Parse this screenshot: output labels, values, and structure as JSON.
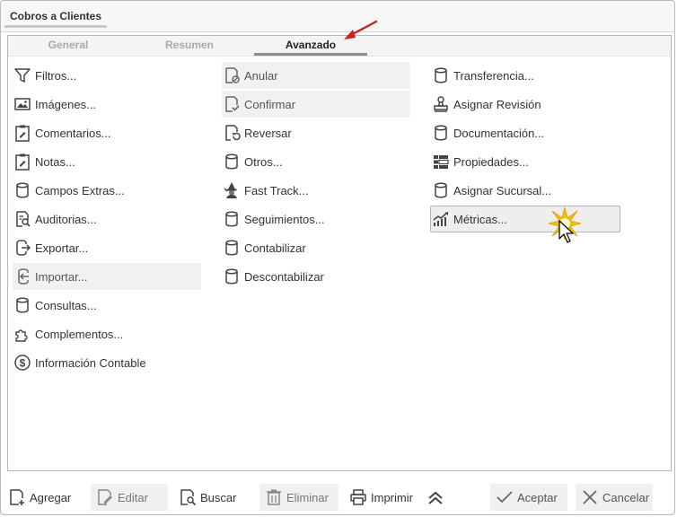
{
  "window": {
    "title": "Cobros a Clientes"
  },
  "tabs": [
    {
      "label": "General",
      "active": false
    },
    {
      "label": "Resumen",
      "active": false
    },
    {
      "label": "Avanzado",
      "active": true
    }
  ],
  "columns": {
    "left": [
      {
        "label": "Filtros...",
        "icon": "filter-icon"
      },
      {
        "label": "Imágenes...",
        "icon": "image-icon"
      },
      {
        "label": "Comentarios...",
        "icon": "clipboard-edit-icon"
      },
      {
        "label": "Notas...",
        "icon": "clipboard-edit-icon"
      },
      {
        "label": "Campos Extras...",
        "icon": "database-icon"
      },
      {
        "label": "Auditorias...",
        "icon": "audit-icon"
      },
      {
        "label": "Exportar...",
        "icon": "export-icon"
      },
      {
        "label": "Importar...",
        "icon": "import-icon"
      },
      {
        "label": "Consultas...",
        "icon": "database-icon"
      },
      {
        "label": "Complementos...",
        "icon": "puzzle-icon"
      },
      {
        "label": "Información Contable",
        "icon": "dollar-circle-icon"
      }
    ],
    "middle": [
      {
        "label": "Anular",
        "icon": "document-cancel-icon"
      },
      {
        "label": "Confirmar",
        "icon": "document-check-icon"
      },
      {
        "label": "Reversar",
        "icon": "document-revert-icon"
      },
      {
        "label": "Otros...",
        "icon": "database-icon"
      },
      {
        "label": "Fast Track...",
        "icon": "wizard-icon"
      },
      {
        "label": "Seguimientos...",
        "icon": "database-icon"
      },
      {
        "label": "Contabilizar",
        "icon": "database-icon"
      },
      {
        "label": "Descontabilizar",
        "icon": "database-icon"
      }
    ],
    "right": [
      {
        "label": "Transferencia...",
        "icon": "database-icon"
      },
      {
        "label": "Asignar Revisión",
        "icon": "stamp-icon"
      },
      {
        "label": "Documentación...",
        "icon": "database-icon"
      },
      {
        "label": "Propiedades...",
        "icon": "properties-icon"
      },
      {
        "label": "Asignar Sucursal...",
        "icon": "database-icon"
      },
      {
        "label": "Métricas...",
        "icon": "chart-trend-icon"
      }
    ]
  },
  "toolbar": {
    "agregar": "Agregar",
    "editar": "Editar",
    "buscar": "Buscar",
    "eliminar": "Eliminar",
    "imprimir": "Imprimir",
    "aceptar": "Aceptar",
    "cancelar": "Cancelar"
  },
  "colors": {
    "annotation_arrow": "#cc1f1f",
    "highlight_burst": "#f2c200"
  }
}
